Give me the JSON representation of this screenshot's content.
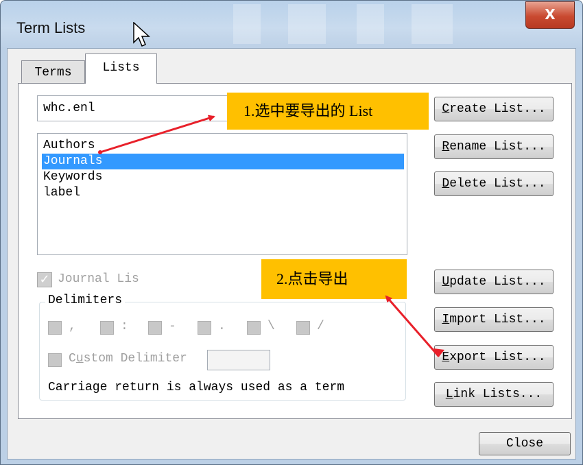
{
  "window": {
    "title": "Term Lists",
    "close_glyph": "X",
    "close_color": "#c94a30"
  },
  "tabs": [
    {
      "label": "Terms",
      "selected": false
    },
    {
      "label": "Lists",
      "selected": true
    }
  ],
  "lists_tab": {
    "file_name": "whc.enl",
    "list_items": [
      "Authors",
      "Journals",
      "Keywords",
      "label"
    ],
    "selected_item": "Journals",
    "buttons": {
      "create": {
        "accel": "C",
        "rest": "reate List..."
      },
      "rename": {
        "accel": "R",
        "rest": "ename List..."
      },
      "delete": {
        "accel": "D",
        "rest": "elete List..."
      },
      "update": {
        "accel": "U",
        "rest": "pdate List..."
      },
      "import": {
        "accel": "I",
        "rest": "mport List..."
      },
      "export": {
        "accel": "E",
        "rest": "xport List..."
      },
      "link": {
        "accel": "L",
        "rest": "ink Lists..."
      }
    },
    "journal_list_label": "Journal Lis",
    "journal_list_checked": true,
    "delimiters": {
      "legend": "Delimiters",
      "options": [
        ",",
        ":",
        "-",
        ".",
        "\\",
        "/"
      ],
      "custom_label_pre": "C",
      "custom_label_accel": "u",
      "custom_label_post": "stom Delimiter",
      "custom_value": ""
    },
    "carriage_note": "Carriage return is always used as a term"
  },
  "footer": {
    "close_label": "Close"
  },
  "annotations": {
    "callout1": "1.选中要导出的 List",
    "callout2": "2.点击导出",
    "callout_color": "#ffc000",
    "arrow_color": "#e8202a"
  }
}
